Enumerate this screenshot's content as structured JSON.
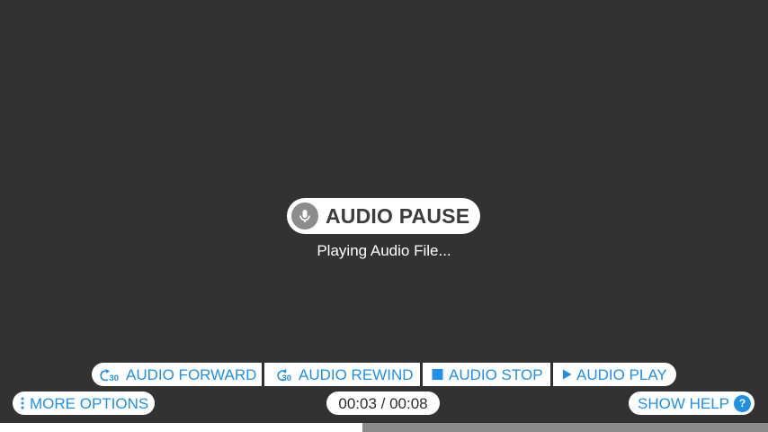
{
  "status_pill": {
    "label": "AUDIO PAUSE",
    "icon": "microphone-icon"
  },
  "status_text": "Playing Audio File...",
  "controls": {
    "forward": {
      "label": "AUDIO FORWARD",
      "icon": "forward-30-icon",
      "icon_text": "30"
    },
    "rewind": {
      "label": "AUDIO REWIND",
      "icon": "rewind-30-icon",
      "icon_text": "30"
    },
    "stop": {
      "label": "AUDIO STOP",
      "icon": "stop-icon"
    },
    "play": {
      "label": "AUDIO PLAY",
      "icon": "play-icon"
    }
  },
  "more_options": {
    "label": "MORE OPTIONS",
    "icon": "more-vertical-icon"
  },
  "time": "00:03 / 00:08",
  "help": {
    "label": "SHOW HELP",
    "icon_text": "?"
  },
  "progress": {
    "fraction": 0.472
  },
  "colors": {
    "background": "#323232",
    "accent": "#1e90e6",
    "pill": "#ffffff",
    "mic_circle": "#8c8c8c",
    "progress_track": "#8a8a8a"
  }
}
